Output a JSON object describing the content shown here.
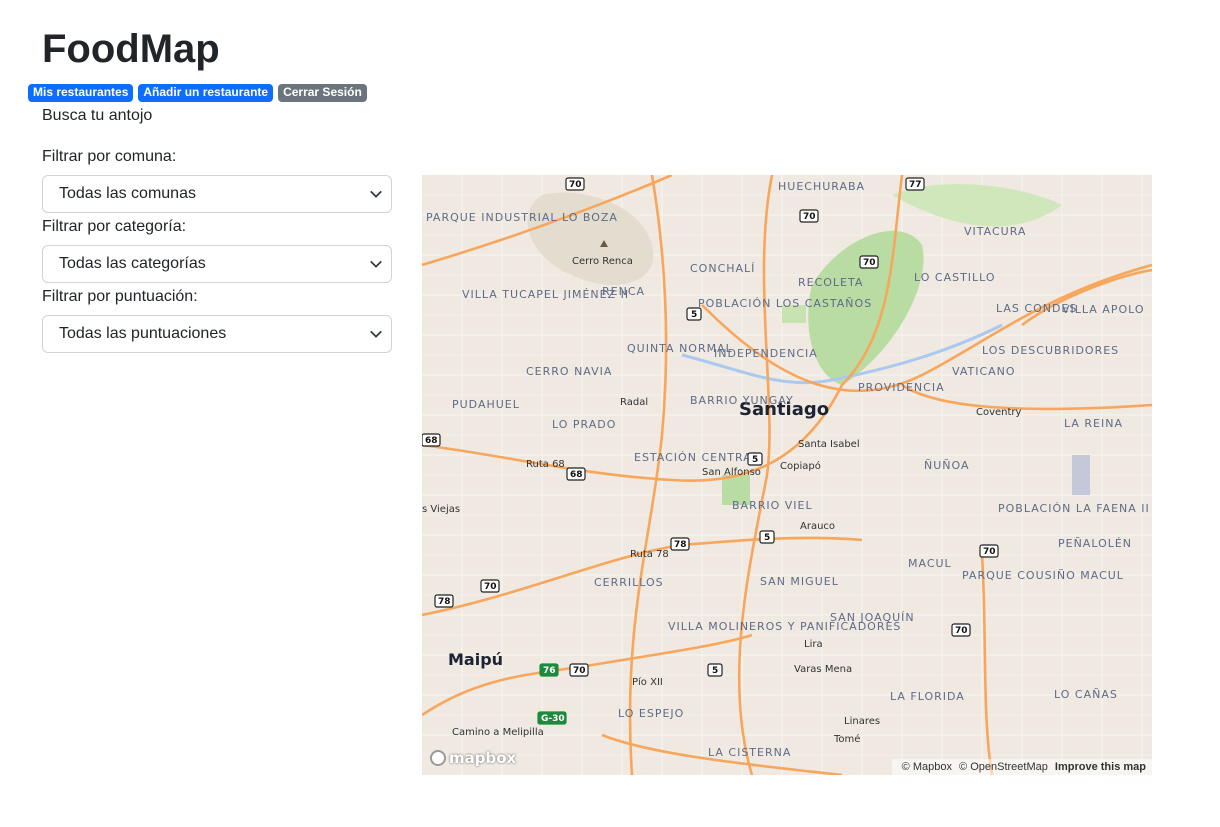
{
  "app": {
    "title": "FoodMap",
    "subtitle": "Busca tu antojo"
  },
  "nav": [
    {
      "label": "Mis restaurantes",
      "color": "#0d6efd"
    },
    {
      "label": "Añadir un restaurante",
      "color": "#0d6efd"
    },
    {
      "label": "Cerrar Sesión",
      "color": "#6c757d"
    }
  ],
  "filters": {
    "comuna": {
      "label": "Filtrar por comuna:",
      "value": "Todas las comunas"
    },
    "categoria": {
      "label": "Filtrar por categoría:",
      "value": "Todas las categorías"
    },
    "puntuacion": {
      "label": "Filtrar por puntuación:",
      "value": "Todas las puntuaciones"
    }
  },
  "map": {
    "city": "Santiago",
    "labels": {
      "huechuraba": "HUECHURABA",
      "vitacura": "VITACURA",
      "conchali": "CONCHALÍ",
      "recoleta": "RECOLETA",
      "renca": "RENCA",
      "cerro_renca": "Cerro Renca",
      "independencia": "INDEPENDENCIA",
      "quinta_normal": "QUINTA NORMAL",
      "providencia": "PROVIDENCIA",
      "pudahuel": "PUDAHUEL",
      "lo_prado": "LO PRADO",
      "cerro_navia": "CERRO NAVIA",
      "estacion_central": "ESTACIÓN CENTRAL",
      "barrio_viel": "BARRIO VIEL",
      "nunoa": "ÑUÑOA",
      "la_reina": "LA REINA",
      "macul": "MACUL",
      "san_miguel": "SAN MIGUEL",
      "san_joaquin": "SAN JOAQUÍN",
      "cerrillos": "CERRILLOS",
      "maipu": "Maipú",
      "lo_espejo": "LO ESPEJO",
      "la_cisterna": "LA CISTERNA",
      "la_florida": "LA FLORIDA",
      "penalolen": "PEÑALOLÉN",
      "lo_castillo": "LO CASTILLO",
      "las_condes": "LAS CONDES",
      "villa_apolo": "VILLA APOLO",
      "vaticano": "VATICANO",
      "los_descubridores": "LOS DESCUBRIDORES",
      "lo_canas": "LO CAÑAS",
      "parque_industrial": "PARQUE INDUSTRIAL LO BOZA",
      "villa_tucapel": "VILLA TUCAPEL JIMÉNEZ II",
      "barrio_yungay": "BARRIO YUNGAY",
      "poblacion_castanos": "POBLACIÓN LOS CASTAÑOS",
      "villa_molineros": "VILLA MOLINEROS Y PANIFICADORES",
      "parque_cousino": "PARQUE COUSIÑO MACUL",
      "poblacion_faena": "POBLACIÓN LA FAENA II",
      "ruta68": "Ruta 68",
      "ruta78": "Ruta 78",
      "santa_isabel": "Santa Isabel",
      "copiapo": "Copiapó",
      "arauco": "Arauco",
      "san_alfonso": "San Alfonso",
      "radal": "Radal",
      "lo_viejas": "s Viejas",
      "lira": "Lira",
      "varas_mena": "Varas Mena",
      "linares": "Linares",
      "tome": "Tomé",
      "pio_xii": "Pío XII",
      "camino_melipilla": "Camino a Melipilla",
      "coventry": "Coventry"
    },
    "shields": [
      "70",
      "77",
      "70",
      "70",
      "5",
      "68",
      "68",
      "5",
      "78",
      "5",
      "70",
      "78",
      "70",
      "5",
      "76",
      "70",
      "G-30",
      "70"
    ],
    "logo": "mapbox",
    "attribution": {
      "mapbox": "© Mapbox",
      "osm": "© OpenStreetMap",
      "improve": "Improve this map"
    }
  }
}
